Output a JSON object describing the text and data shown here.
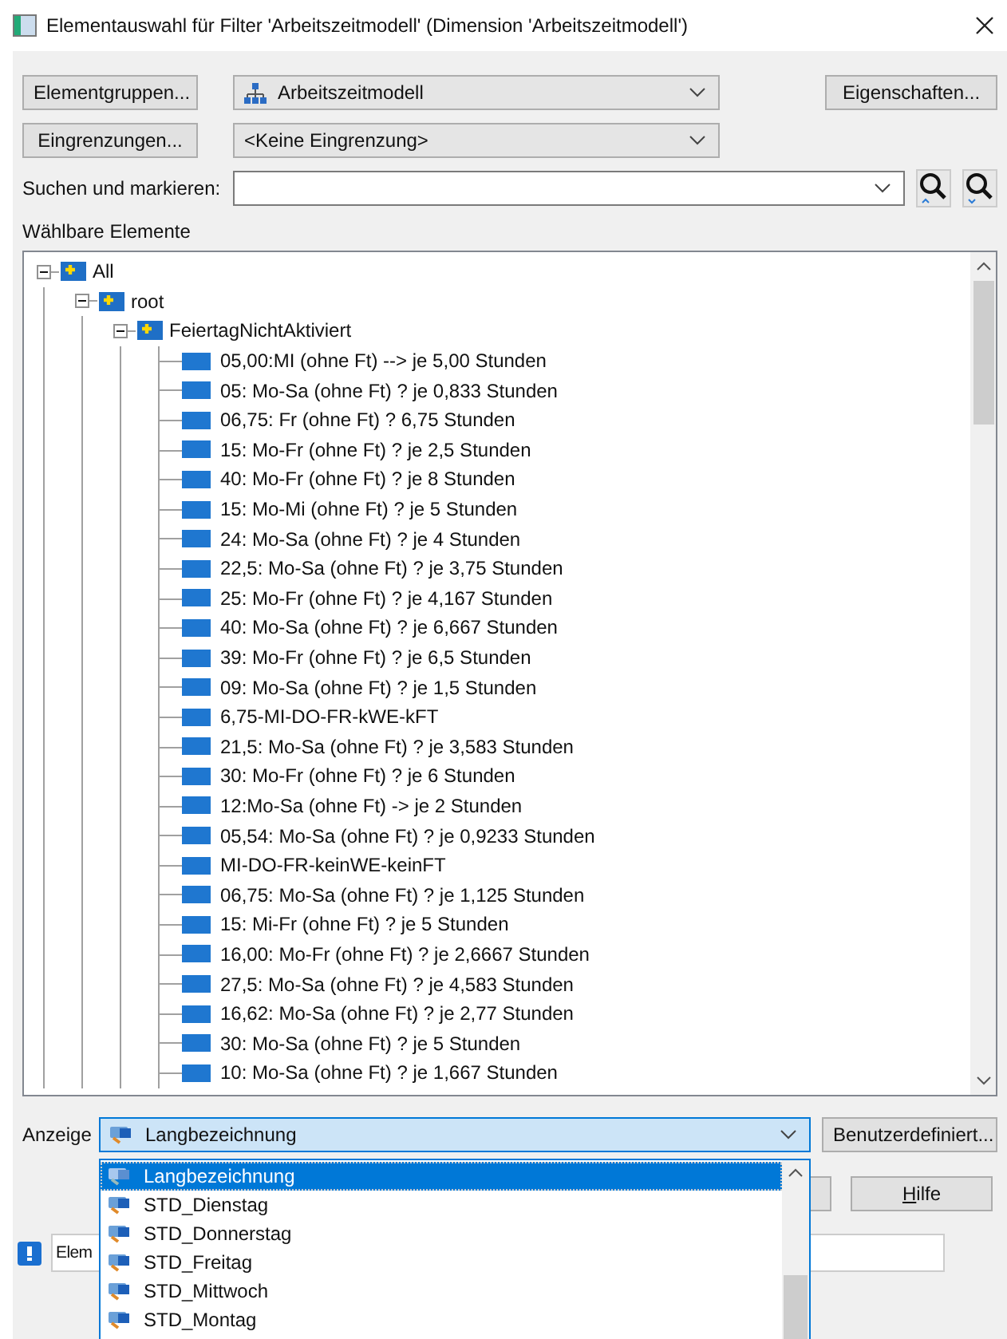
{
  "window": {
    "title": "Elementauswahl für Filter 'Arbeitszeitmodell' (Dimension 'Arbeitszeitmodell')"
  },
  "toolbar": {
    "element_groups_button": "Elementgruppen...",
    "hierarchy_select": "Arbeitszeitmodell",
    "properties_button": "Eigenschaften...",
    "restrictions_button": "Eingrenzungen...",
    "restriction_select": "<Keine Eingrenzung>",
    "search_label": "Suchen und markieren:"
  },
  "tree": {
    "label": "Wählbare Elemente",
    "items": [
      {
        "label": "All",
        "expanded": true,
        "children": [
          {
            "label": "root",
            "expanded": true,
            "children": [
              {
                "label": "FeiertagNichtAktiviert",
                "expanded": true,
                "children": [
                  {
                    "label": "05,00:MI (ohne Ft) --> je 5,00 Stunden"
                  },
                  {
                    "label": "05: Mo-Sa (ohne Ft) ? je 0,833 Stunden"
                  },
                  {
                    "label": "06,75: Fr (ohne Ft) ? 6,75 Stunden"
                  },
                  {
                    "label": "15: Mo-Fr (ohne Ft) ? je 2,5 Stunden"
                  },
                  {
                    "label": "40: Mo-Fr (ohne Ft) ? je 8 Stunden"
                  },
                  {
                    "label": "15: Mo-Mi (ohne Ft) ? je 5 Stunden"
                  },
                  {
                    "label": "24: Mo-Sa (ohne Ft) ? je 4 Stunden"
                  },
                  {
                    "label": "22,5: Mo-Sa (ohne Ft) ? je 3,75 Stunden"
                  },
                  {
                    "label": "25: Mo-Fr (ohne Ft) ? je 4,167 Stunden"
                  },
                  {
                    "label": "40: Mo-Sa (ohne Ft) ? je 6,667 Stunden"
                  },
                  {
                    "label": "39: Mo-Fr (ohne Ft) ? je 6,5 Stunden"
                  },
                  {
                    "label": "09: Mo-Sa (ohne Ft) ? je 1,5 Stunden"
                  },
                  {
                    "label": "6,75-MI-DO-FR-kWE-kFT"
                  },
                  {
                    "label": "21,5: Mo-Sa (ohne Ft) ? je 3,583 Stunden"
                  },
                  {
                    "label": "30: Mo-Fr (ohne Ft) ? je 6 Stunden"
                  },
                  {
                    "label": "12:Mo-Sa (ohne Ft) -> je 2 Stunden"
                  },
                  {
                    "label": "05,54: Mo-Sa (ohne Ft) ? je 0,9233 Stunden"
                  },
                  {
                    "label": "MI-DO-FR-keinWE-keinFT"
                  },
                  {
                    "label": "06,75: Mo-Sa (ohne Ft) ? je 1,125 Stunden"
                  },
                  {
                    "label": "15: Mi-Fr (ohne Ft) ? je 5 Stunden"
                  },
                  {
                    "label": "16,00: Mo-Fr (ohne Ft) ? je 2,6667 Stunden"
                  },
                  {
                    "label": "27,5: Mo-Sa (ohne Ft) ? je 4,583 Stunden"
                  },
                  {
                    "label": "16,62: Mo-Sa (ohne Ft) ? je 2,77 Stunden"
                  },
                  {
                    "label": "30: Mo-Sa (ohne Ft) ? je 5 Stunden"
                  },
                  {
                    "label": "10: Mo-Sa (ohne Ft) ? je 1,667 Stunden"
                  }
                ]
              }
            ]
          }
        ]
      }
    ]
  },
  "display": {
    "label": "Anzeige",
    "value": "Langbezeichnung",
    "custom_button": "Benutzerdefiniert...",
    "help_button": "Hilfe",
    "options": [
      {
        "label": "Langbezeichnung",
        "selected": true
      },
      {
        "label": "STD_Dienstag",
        "selected": false
      },
      {
        "label": "STD_Donnerstag",
        "selected": false
      },
      {
        "label": "STD_Freitag",
        "selected": false
      },
      {
        "label": "STD_Mittwoch",
        "selected": false
      },
      {
        "label": "STD_Montag",
        "selected": false
      }
    ]
  },
  "status": {
    "text": "Elem"
  }
}
